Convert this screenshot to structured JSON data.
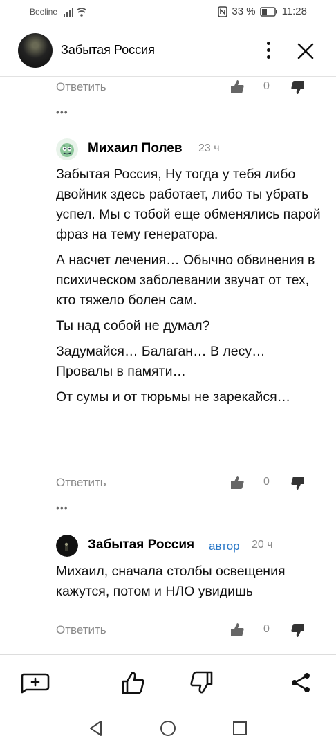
{
  "status_bar": {
    "carrier": "Beeline",
    "battery_percent": "33 %",
    "time": "11:28"
  },
  "header": {
    "channel_name": "Забытая Россия"
  },
  "actions": {
    "reply_label": "Ответить",
    "like_count": "0",
    "more": "•••"
  },
  "comments": [
    {
      "author": "Михаил Полев",
      "time": "23 ч",
      "paragraphs": [
        "Забытая Россия, Ну тогда у тебя либо двойник здесь работает, либо ты убрать успел. Мы с тобой еще обменялись парой фраз на тему генератора.",
        "А насчет лечения… Обычно обвинения в психическом заболевании звучат от тех, кто тяжело болен сам.",
        "Ты над собой не думал?",
        "Задумайся… Балаган… В лесу… Провалы в памяти…",
        "От сумы и от тюрьмы не зарекайся…"
      ]
    },
    {
      "author": "Забытая Россия",
      "badge": "автор",
      "time": "20 ч",
      "paragraphs": [
        "Михаил, сначала столбы освещения кажутся, потом и НЛО увидишь"
      ]
    }
  ],
  "colors": {
    "author_badge": "#2a78c8",
    "muted_text": "#8a8a8a"
  }
}
